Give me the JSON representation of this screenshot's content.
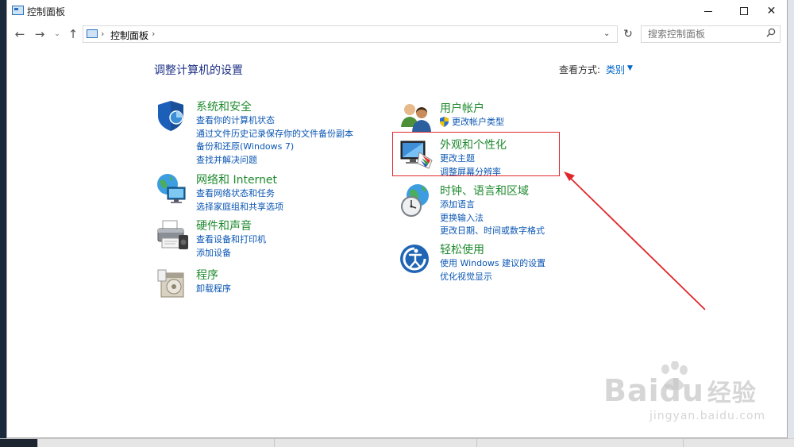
{
  "window": {
    "title": "控制面板",
    "controls": {
      "minimize": "minimize",
      "maximize": "maximize",
      "close": "✕"
    }
  },
  "nav": {
    "back": "←",
    "forward": "→",
    "recent": "⌄",
    "up": "↑",
    "address": {
      "crumb": "控制面板",
      "separator": "›"
    },
    "refresh": "↻",
    "search": {
      "placeholder": "搜索控制面板",
      "value": ""
    }
  },
  "content": {
    "heading": "调整计算机的设置",
    "view_by_label": "查看方式:",
    "view_by_value": "类别"
  },
  "categories_left": [
    {
      "title": "系统和安全",
      "icon": "shield-icon",
      "links": [
        "查看你的计算机状态",
        "通过文件历史记录保存你的文件备份副本",
        "备份和还原(Windows 7)",
        "查找并解决问题"
      ]
    },
    {
      "title": "网络和 Internet",
      "icon": "network-globe-icon",
      "links": [
        "查看网络状态和任务",
        "选择家庭组和共享选项"
      ]
    },
    {
      "title": "硬件和声音",
      "icon": "printer-icon",
      "links": [
        "查看设备和打印机",
        "添加设备"
      ]
    },
    {
      "title": "程序",
      "icon": "programs-icon",
      "links": [
        "卸载程序"
      ]
    }
  ],
  "categories_right": [
    {
      "title": "用户帐户",
      "icon": "users-icon",
      "links": [
        "更改帐户类型"
      ]
    },
    {
      "title": "外观和个性化",
      "icon": "monitor-palette-icon",
      "links": [
        "更改主题",
        "调整屏幕分辨率"
      ]
    },
    {
      "title": "时钟、语言和区域",
      "icon": "clock-globe-icon",
      "links": [
        "添加语言",
        "更换输入法",
        "更改日期、时间或数字格式"
      ]
    },
    {
      "title": "轻松使用",
      "icon": "ease-of-access-icon",
      "links": [
        "使用 Windows 建议的设置",
        "优化视觉显示"
      ]
    }
  ],
  "watermark": {
    "brand": "Baidu",
    "brand_cn": "经验",
    "url": "jingyan.baidu.com"
  },
  "colors": {
    "category_title": "#1e8a2e",
    "link": "#0a56b3",
    "heading": "#1e3287",
    "highlight": "#e0282c"
  }
}
